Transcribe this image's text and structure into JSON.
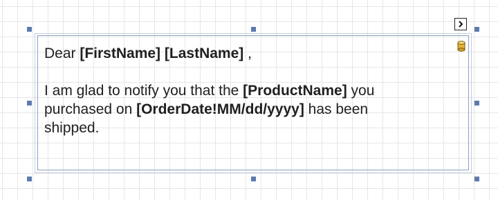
{
  "rich_text": {
    "line1": {
      "greeting": "Dear ",
      "field_first_name": "[FirstName]",
      "sep": " ",
      "field_last_name": "[LastName]",
      "trail": " ,"
    },
    "line2": {
      "text_before": "I am glad to notify you that the ",
      "field_product": "[ProductName]",
      "text_after": "  you"
    },
    "line3": {
      "text_before": "purchased on ",
      "field_order_date": "[OrderDate!MM/dd/yyyy]",
      "text_after": "  has been"
    },
    "line4": {
      "text": "shipped."
    }
  },
  "icons": {
    "smart_tag": "chevron-right-icon",
    "data_bound": "database-icon"
  },
  "colors": {
    "grid_line": "#e6e6e6",
    "selection_handle": "#5b7bb0",
    "control_border": "#8c9fc4",
    "database_icon": "#e3b338"
  }
}
